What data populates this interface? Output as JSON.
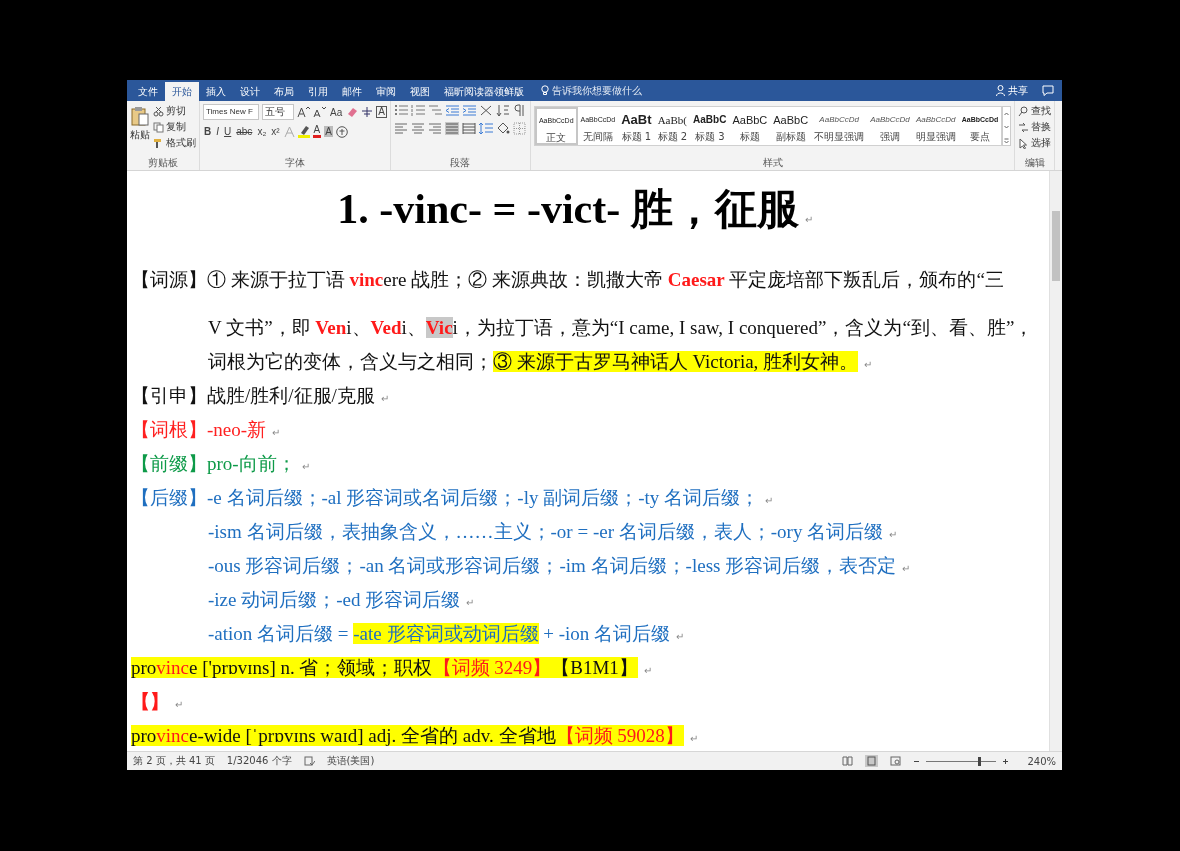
{
  "window": {
    "tabs": [
      {
        "label": "文件",
        "selected": false
      },
      {
        "label": "开始",
        "selected": true
      },
      {
        "label": "插入",
        "selected": false
      },
      {
        "label": "设计",
        "selected": false
      },
      {
        "label": "布局",
        "selected": false
      },
      {
        "label": "引用",
        "selected": false
      },
      {
        "label": "邮件",
        "selected": false
      },
      {
        "label": "审阅",
        "selected": false
      },
      {
        "label": "视图",
        "selected": false
      },
      {
        "label": "福昕阅读器领鲜版",
        "selected": false
      }
    ],
    "tell_me": "告诉我你想要做什么",
    "share": "共享"
  },
  "ribbon": {
    "clipboard": {
      "paste": "粘贴",
      "cut": "剪切",
      "copy": "复制",
      "format_painter": "格式刷",
      "group_label": "剪贴板"
    },
    "font": {
      "font_name": "Times New F",
      "font_size": "五号",
      "change_case": "Aa",
      "format_letters": [
        "B",
        "I",
        "U",
        "abc",
        "x₂",
        "x²"
      ],
      "font_color_letter": "A",
      "shading_letter": "A",
      "border_letter": "A",
      "group_label": "字体"
    },
    "paragraph": {
      "alignment_buttons": [
        {
          "kind": "left",
          "selected": false
        },
        {
          "kind": "center",
          "selected": false
        },
        {
          "kind": "right",
          "selected": false
        },
        {
          "kind": "justify",
          "selected": true
        },
        {
          "kind": "distributed",
          "selected": false
        }
      ],
      "group_label": "段落"
    },
    "styles": {
      "items": [
        {
          "kind": "normal",
          "preview": "AaBbCcDd",
          "name": "正文",
          "selected": true
        },
        {
          "kind": "normal",
          "preview": "AaBbCcDd",
          "name": "无间隔",
          "selected": false
        },
        {
          "kind": "heading1",
          "preview": "AaBt",
          "name": "标题 1",
          "selected": false
        },
        {
          "kind": "heading2",
          "preview": "AaBb(",
          "name": "标题 2",
          "selected": false
        },
        {
          "kind": "heading3",
          "preview": "AaBbC",
          "name": "标题 3",
          "selected": false
        },
        {
          "kind": "title",
          "preview": "AaBbC",
          "name": "标题",
          "selected": false
        },
        {
          "kind": "title",
          "preview": "AaBbC",
          "name": "副标题",
          "selected": false
        },
        {
          "kind": "emphasis",
          "preview": "AaBbCcDd",
          "name": "不明显强调",
          "selected": false
        },
        {
          "kind": "emphasis",
          "preview": "AaBbCcDd",
          "name": "强调",
          "selected": false
        },
        {
          "kind": "emphasis",
          "preview": "AaBbCcDd",
          "name": "明显强调",
          "selected": false
        },
        {
          "kind": "strong",
          "preview": "AaBbCcDd",
          "name": "要点",
          "selected": false
        }
      ],
      "group_label": "样式"
    },
    "editing": {
      "find": "查找",
      "replace": "替换",
      "select": "选择",
      "group_label": "编辑"
    }
  },
  "document": {
    "title": "1. -vinc- = -vict-  胜，征服",
    "title_end_mark": "↵",
    "paragraphs": [
      {
        "kind": "black",
        "runs": [
          {
            "kind": "plain",
            "text": "【词源】①  来源于拉丁语 "
          },
          {
            "kind": "emph",
            "text": "vinc"
          },
          {
            "kind": "plain",
            "text": "ere 战胜；②  来源典故：凯撒大帝 "
          },
          {
            "kind": "emph",
            "text": "Caesar"
          },
          {
            "kind": "plain",
            "text": " 平定庞培部下叛乱后，颁布的“三"
          }
        ],
        "continuation": [
          {
            "runs": [
              {
                "kind": "plain",
                "text": "V 文书”，即 "
              },
              {
                "kind": "emph",
                "text": "Ven"
              },
              {
                "kind": "plain",
                "text": "i、"
              },
              {
                "kind": "emph",
                "text": "Ved"
              },
              {
                "kind": "plain",
                "text": "i、"
              },
              {
                "kind": "emph-shaded",
                "text": "Vic"
              },
              {
                "kind": "plain",
                "text": "i，为拉丁语，意为“I came, I saw, I conquered”，含义为“到、看、胜”，"
              }
            ]
          },
          {
            "runs": [
              {
                "kind": "plain",
                "text": "词根为它的变体，含义与之相同；"
              },
              {
                "kind": "hl",
                "text": "③  来源于古罗马神话人 Victoria, 胜利女神。"
              }
            ],
            "end_mark": "↵"
          }
        ]
      },
      {
        "kind": "black",
        "runs": [
          {
            "kind": "plain",
            "text": "【引申】战胜/胜利/征服/克服"
          }
        ],
        "end_mark": "↵"
      },
      {
        "kind": "red",
        "runs": [
          {
            "kind": "plain",
            "text": "【词根】-neo-新"
          }
        ],
        "end_mark": "↵"
      },
      {
        "kind": "green",
        "runs": [
          {
            "kind": "plain",
            "text": "【前缀】pro-向前；"
          }
        ],
        "end_mark": "↵"
      },
      {
        "kind": "blue",
        "runs": [
          {
            "kind": "plain",
            "text": "【后缀】-e 名词后缀；-al 形容词或名词后缀；-ly 副词后缀；-ty 名词后缀；"
          }
        ],
        "end_mark": "↵",
        "continuation": [
          {
            "runs": [
              {
                "kind": "plain",
                "text": "-ism 名词后缀，表抽象含义，……主义；-or = -er 名词后缀，表人；-ory 名词后缀"
              }
            ],
            "end_mark": "↵"
          },
          {
            "runs": [
              {
                "kind": "plain",
                "text": "-ous 形容词后缀；-an 名词或形容词后缀；-im 名词后缀；-less 形容词后缀，表否定"
              }
            ],
            "end_mark": "↵"
          },
          {
            "runs": [
              {
                "kind": "plain",
                "text": "-ize 动词后缀；-ed 形容词后缀"
              }
            ],
            "end_mark": "↵"
          },
          {
            "runs": [
              {
                "kind": "plain",
                "text": "-ation 名词后缀  = "
              },
              {
                "kind": "hl",
                "text": "-ate 形容词或动词后缀"
              },
              {
                "kind": "plain",
                "text": "  + -ion 名词后缀"
              }
            ],
            "end_mark": "↵"
          }
        ]
      },
      {
        "kind": "entry",
        "runs": [
          {
            "kind": "plain",
            "text": "pro"
          },
          {
            "kind": "red",
            "text": "vinc"
          },
          {
            "kind": "plain",
            "text": "e ['prɒvɪns] n.  省；领域；职权"
          },
          {
            "kind": "red",
            "text": "【词频 3249】"
          },
          {
            "kind": "plain",
            "text": "【B1M1】"
          }
        ],
        "end_mark": "↵"
      },
      {
        "kind": "red",
        "runs": [
          {
            "kind": "emph",
            "text": "【】"
          }
        ],
        "end_mark": "↵"
      },
      {
        "kind": "entry",
        "runs": [
          {
            "kind": "plain",
            "text": "pro"
          },
          {
            "kind": "red",
            "text": "vinc"
          },
          {
            "kind": "plain",
            "text": "e-wide [ˈprɒvɪns waɪd] adj.  全省的  adv.  全省地"
          },
          {
            "kind": "red",
            "text": "【词频 59028】"
          }
        ],
        "end_mark": "↵"
      }
    ]
  },
  "status_bar": {
    "page": "第 2 页，共 41 页",
    "words": "1/32046 个字",
    "language": "英语(美国)",
    "zoom": {
      "level": 0.75,
      "reading": "240%"
    }
  }
}
